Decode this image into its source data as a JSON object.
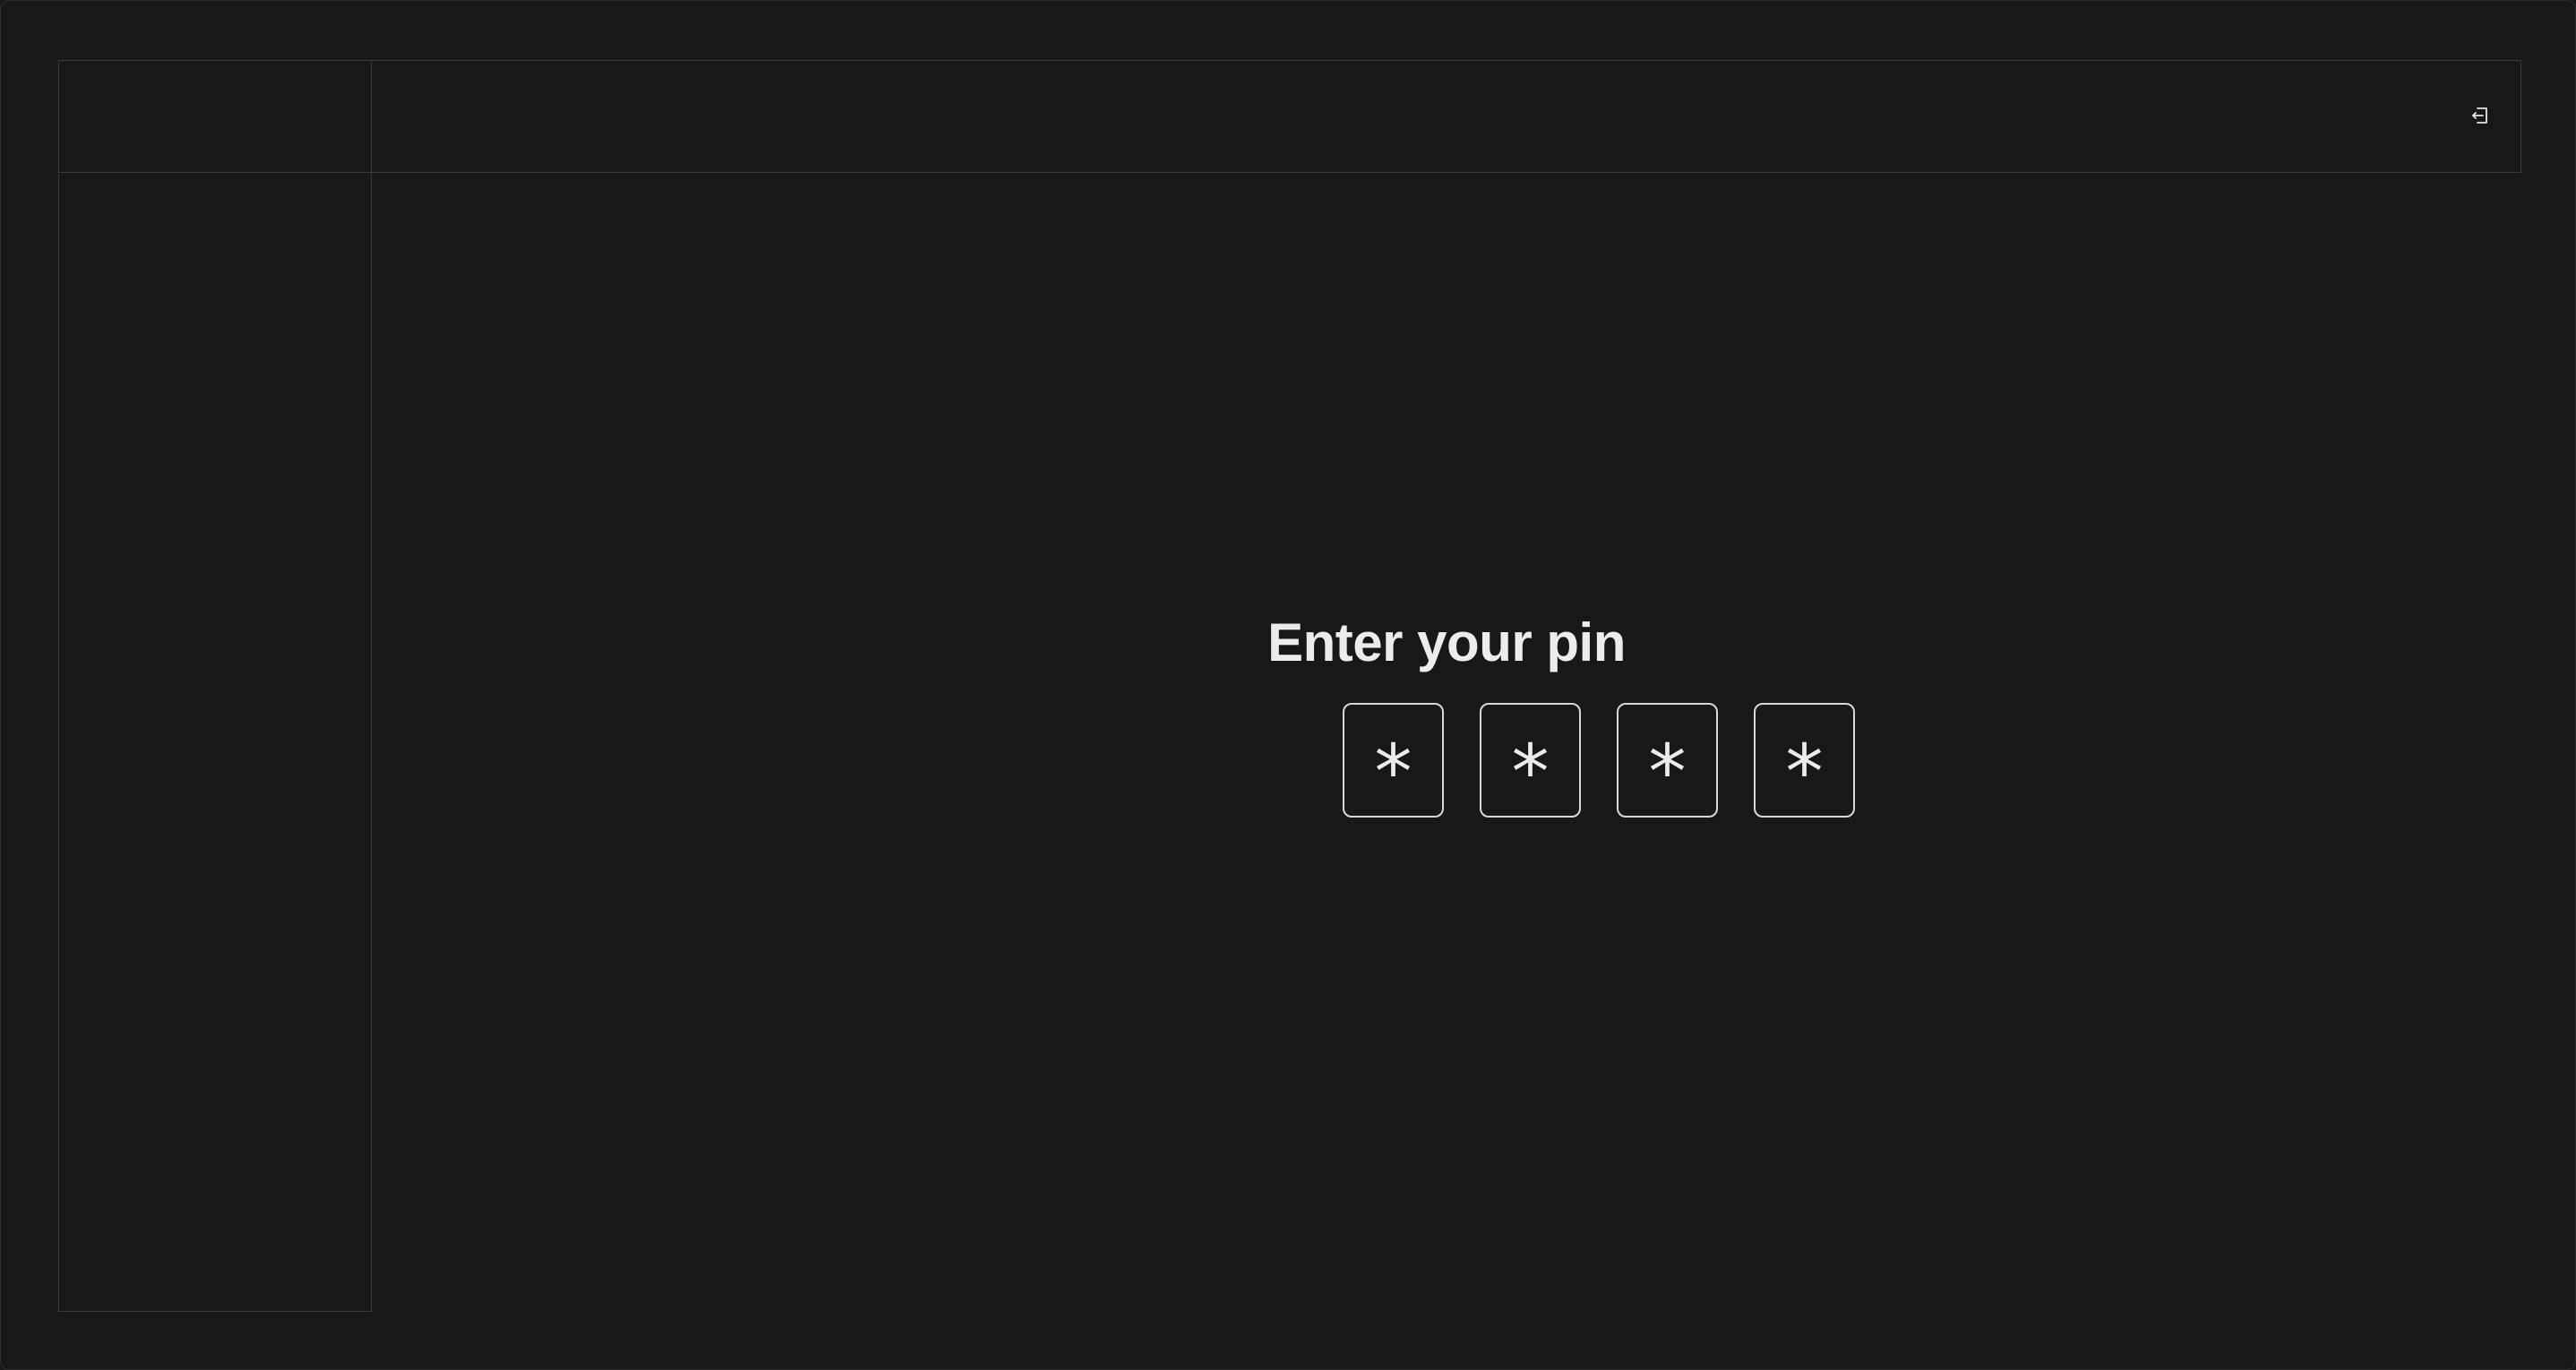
{
  "pin_prompt": {
    "title": "Enter your pin",
    "digits": [
      "*",
      "*",
      "*",
      "*"
    ]
  },
  "topbar": {
    "logout_icon": "logout-icon"
  },
  "colors": {
    "background": "#181818",
    "border": "#3a3a3a",
    "text": "#ececec",
    "pin_box_border": "#d8d8d8"
  }
}
